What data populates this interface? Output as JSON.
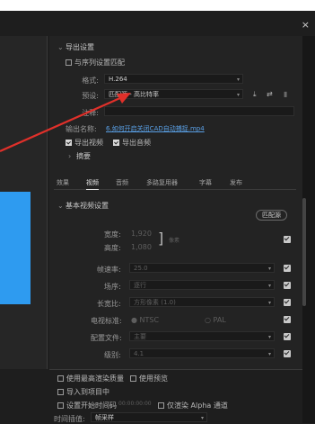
{
  "dialog": {
    "close": "×"
  },
  "export_settings": {
    "header": "导出设置",
    "match_sequence": "与序列设置匹配",
    "format_label": "格式:",
    "format_value": "H.264",
    "preset_label": "预设:",
    "preset_value": "匹配源 - 高比特率",
    "comment_label": "注释:",
    "comment_value": "",
    "output_name_label": "输出名称:",
    "output_name_value": "6.如何开启关闭CAD自动捕捉.mp4",
    "export_video": "导出视频",
    "export_audio": "导出音频",
    "summary": "摘要"
  },
  "tabs": [
    "效果",
    "视频",
    "音频",
    "多路复用器",
    "字幕",
    "发布"
  ],
  "active_tab": "视频",
  "basic_video": {
    "header": "基本视频设置",
    "match_source_btn": "匹配源",
    "width_label": "宽度:",
    "width_value": "1,920",
    "height_label": "高度:",
    "height_value": "1,080",
    "unit": "像素",
    "framerate_label": "帧速率:",
    "framerate_value": "25.0",
    "field_label": "场序:",
    "field_value": "逐行",
    "aspect_label": "长宽比:",
    "aspect_value": "方形像素 (1.0)",
    "tv_standard_label": "电视标准:",
    "ntsc": "NTSC",
    "pal": "PAL",
    "profile_label": "配置文件:",
    "profile_value": "主要",
    "level_label": "级别:",
    "level_value": "4.1"
  },
  "bottom": {
    "max_render": "使用最高渲染质量",
    "use_previews": "使用预览",
    "import_project": "导入到项目中",
    "set_start_tc": "设置开始时间码",
    "start_tc_value": "00:00:00:00",
    "render_alpha": "仅渲染 Alpha 通道",
    "time_interp_label": "时间插值:",
    "time_interp_value": "帧采样"
  },
  "colors": {
    "accent_blue": "#2e9bf0",
    "arrow_red": "#e0302a",
    "link": "#5aa0e6"
  }
}
